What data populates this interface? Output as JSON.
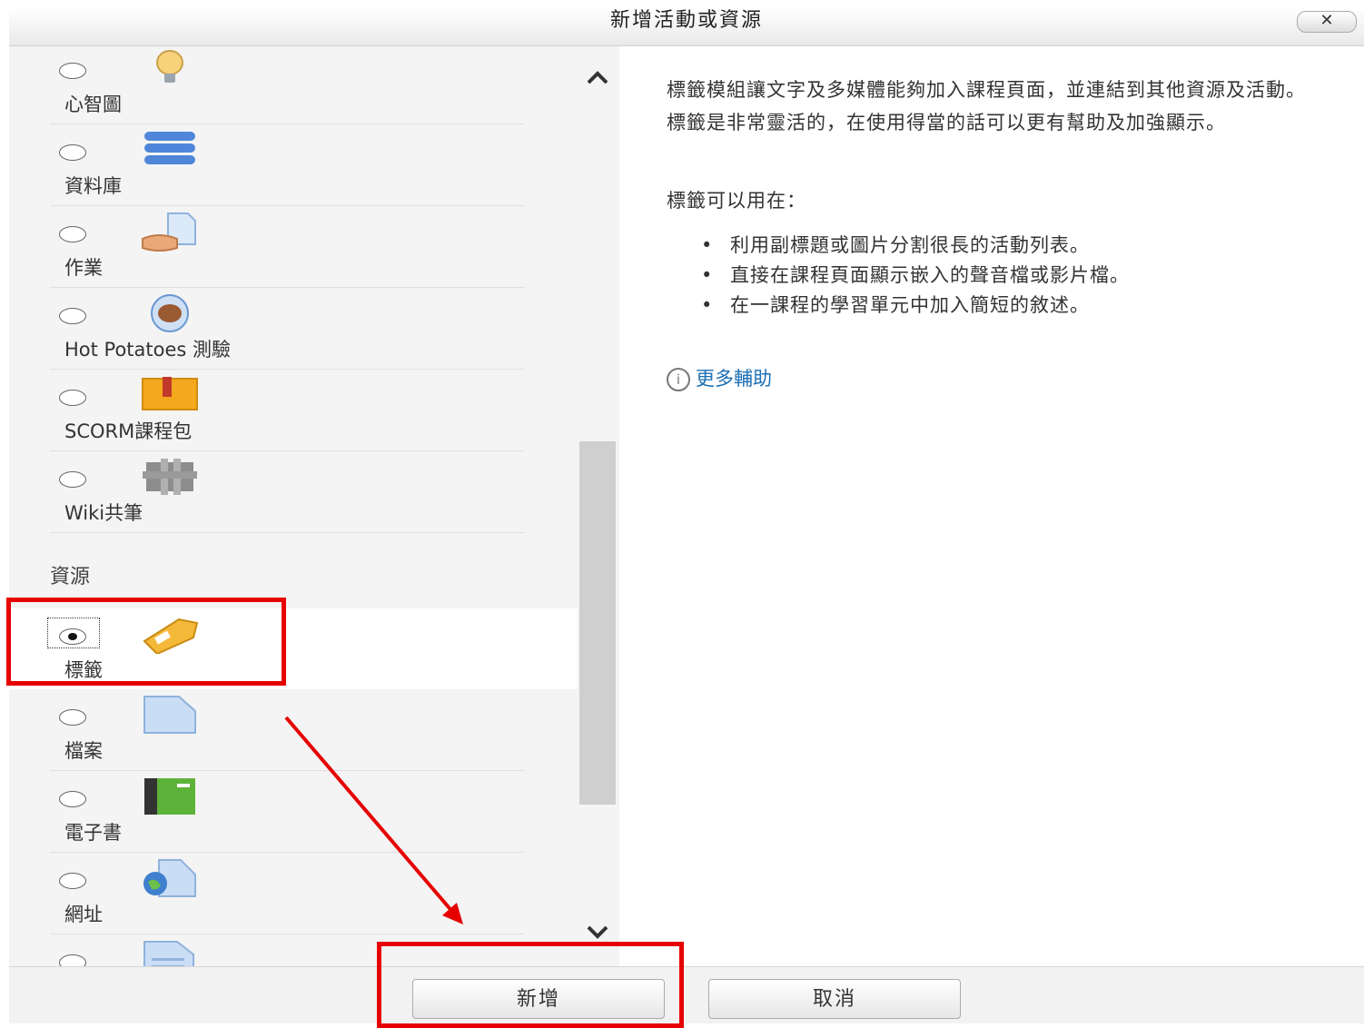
{
  "dialog": {
    "title": "新增活動或資源",
    "close_label": "✕"
  },
  "list": {
    "activities": [
      {
        "label": "心智圖",
        "icon": "lightbulb-icon",
        "selected": false
      },
      {
        "label": "資料庫",
        "icon": "database-icon",
        "selected": false
      },
      {
        "label": "作業",
        "icon": "assignment-icon",
        "selected": false
      },
      {
        "label": "Hot Potatoes 測驗",
        "icon": "hot-potatoes-icon",
        "selected": false
      },
      {
        "label": "SCORM課程包",
        "icon": "scorm-package-icon",
        "selected": false
      },
      {
        "label": "Wiki共筆",
        "icon": "wiki-icon",
        "selected": false
      }
    ],
    "resources_heading": "資源",
    "resources": [
      {
        "label": "標籤",
        "icon": "label-tag-icon",
        "selected": true
      },
      {
        "label": "檔案",
        "icon": "file-icon",
        "selected": false
      },
      {
        "label": "電子書",
        "icon": "book-icon",
        "selected": false
      },
      {
        "label": "網址",
        "icon": "url-icon",
        "selected": false
      },
      {
        "label": "",
        "icon": "page-icon",
        "selected": false
      }
    ]
  },
  "help": {
    "intro": "標籤模組讓文字及多媒體能夠加入課程頁面，並連結到其他資源及活動。標籤是非常靈活的，在使用得當的話可以更有幫助及加強顯示。",
    "usage_heading": "標籤可以用在：",
    "bullets": [
      "利用副標題或圖片分割很長的活動列表。",
      "直接在課程頁面顯示嵌入的聲音檔或影片檔。",
      "在一課程的學習單元中加入簡短的敘述。"
    ],
    "more_help": "更多輔助"
  },
  "footer": {
    "add_label": "新增",
    "cancel_label": "取消"
  },
  "colors": {
    "annotation": "#e60000",
    "link": "#1a6fb5"
  }
}
